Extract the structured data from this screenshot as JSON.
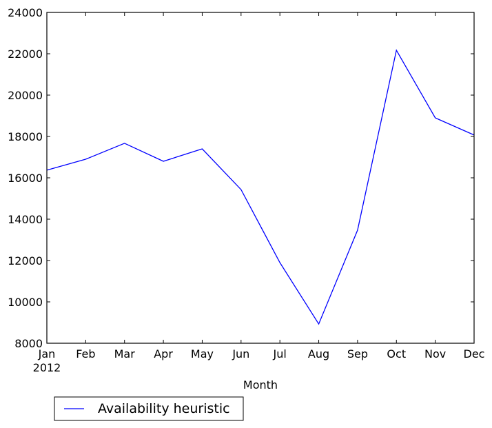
{
  "chart_data": {
    "type": "line",
    "title": "",
    "xlabel": "Month",
    "ylabel": "",
    "categories": [
      "Jan",
      "Feb",
      "Mar",
      "Apr",
      "May",
      "Jun",
      "Jul",
      "Aug",
      "Sep",
      "Oct",
      "Nov",
      "Dec"
    ],
    "x_sublabel": "2012",
    "ylim": [
      8000,
      24000
    ],
    "yticks": [
      8000,
      10000,
      12000,
      14000,
      16000,
      18000,
      20000,
      22000,
      24000
    ],
    "grid": false,
    "legend_position": "below-left",
    "series": [
      {
        "name": "Availability heuristic",
        "color": "#0000ff",
        "values": [
          16370,
          16900,
          17670,
          16800,
          17400,
          15430,
          11900,
          8930,
          13470,
          22170,
          18900,
          18070
        ]
      }
    ]
  }
}
